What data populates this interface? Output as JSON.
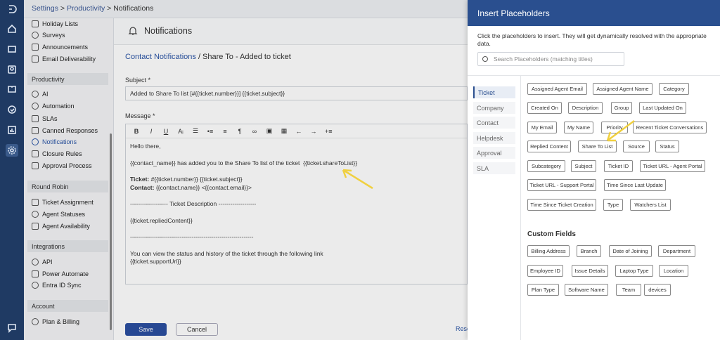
{
  "breadcrumb": {
    "settings": "Settings",
    "sep1": ">",
    "productivity": "Productivity",
    "sep2": ">",
    "current": "Notifications"
  },
  "sidebar": {
    "top_items": [
      {
        "label": "Holiday Lists"
      },
      {
        "label": "Surveys"
      },
      {
        "label": "Announcements"
      },
      {
        "label": "Email Deliverability"
      }
    ],
    "sections": [
      {
        "title": "Productivity",
        "items": [
          {
            "label": "AI"
          },
          {
            "label": "Automation"
          },
          {
            "label": "SLAs"
          },
          {
            "label": "Canned Responses"
          },
          {
            "label": "Notifications"
          },
          {
            "label": "Closure Rules"
          },
          {
            "label": "Approval Process"
          }
        ]
      },
      {
        "title": "Round Robin",
        "items": [
          {
            "label": "Ticket Assignment"
          },
          {
            "label": "Agent Statuses"
          },
          {
            "label": "Agent Availability"
          }
        ]
      },
      {
        "title": "Integrations",
        "items": [
          {
            "label": "API"
          },
          {
            "label": "Power Automate"
          },
          {
            "label": "Entra ID Sync"
          }
        ]
      },
      {
        "title": "Account",
        "items": [
          {
            "label": "Plan & Billing"
          }
        ]
      }
    ]
  },
  "main": {
    "title": "Notifications",
    "sub_link": "Contact Notifications",
    "sub_rest": " / Share To - Added to ticket",
    "subject_label": "Subject *",
    "subject_value": "Added to Share To list [#{{ticket.number}}] {{ticket.subject}}",
    "message_label": "Message *",
    "toolbar": [
      "B",
      "I",
      "U",
      "Aᵢ",
      "☰",
      "•≡",
      "≡",
      "¶",
      "∞",
      "▣",
      "▦",
      "←",
      "→",
      "+≡"
    ],
    "body": {
      "greeting": "Hello there,",
      "line1": "{{contact_name}} has added you to the Share To list of the ticket  {{ticket.shareToList}}",
      "ticket_label": "Ticket:",
      "ticket_value": " #{{ticket.number}} {{ticket.subject}}",
      "contact_label": "Contact:",
      "contact_value": " {{contact.name}} <{{contact.email}}>",
      "desc_header": "------------------- Ticket Description -------------------",
      "replied": "{{ticket.repliedContent}}",
      "rule": "--------------------------------------------------------------",
      "footer1": "You can view the status and history of the ticket through the following link",
      "footer2": "{{ticket.supportUrl}}"
    },
    "save": "Save",
    "cancel": "Cancel",
    "reset": "Reset"
  },
  "panel": {
    "title": "Insert Placeholders",
    "description": "Click the placeholders to insert. They will get dynamically resolved with the appropriate data.",
    "search_placeholder": "Search Placeholders (matching titles)",
    "tabs": [
      "Ticket",
      "Company",
      "Contact",
      "Helpdesk",
      "Approval",
      "SLA"
    ],
    "active_tab": "Ticket",
    "placeholders": [
      "Assigned Agent Email",
      "Assigned Agent Name",
      "Category",
      "Created On",
      "Description",
      "Group",
      "Last Updated On",
      "My Email",
      "My Name",
      "Priority",
      "Recent Ticket Conversations",
      "Replied Content",
      "Share To List",
      "Source",
      "Status",
      "Subcategory",
      "Subject",
      "Ticket ID",
      "Ticket URL - Agent Portal",
      "Ticket URL - Support Portal",
      "Time Since Last Update",
      "Time Since Ticket Creation",
      "Type",
      "Watchers List"
    ],
    "custom_fields_title": "Custom Fields",
    "custom_fields": [
      "Billing Address",
      "Branch",
      "Date of Joining",
      "Department",
      "Employee ID",
      "Issue Details",
      "Laptop Type",
      "Location",
      "Plan Type",
      "Software Name",
      "Team",
      "devices"
    ]
  },
  "colors": {
    "rail": "#1f3a63",
    "panel_header": "#2a4f8f",
    "primary": "#2b4fa0",
    "arrow": "#f0d040"
  }
}
